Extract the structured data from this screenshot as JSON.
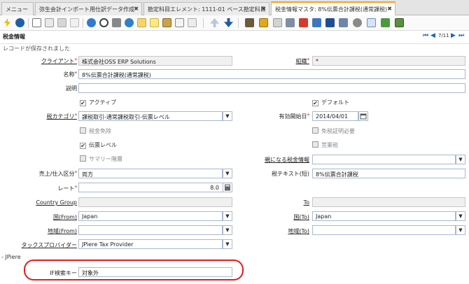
{
  "tabs": [
    {
      "label": "メニュー",
      "close": ""
    },
    {
      "label": "弥生会計インポート用仕訳データ作成",
      "close": "✖"
    },
    {
      "label": "勘定科目エレメント: 1111-01 ベース勘定科目",
      "close": "✖"
    },
    {
      "label": "税金情報マスタ: 8%伝票合計課税(通常課税)",
      "close": "✖"
    }
  ],
  "window_title": "税金情報",
  "nav": {
    "count": "7/11"
  },
  "status_message": "レコードが保存されました",
  "fields": {
    "client": {
      "label": "クライアント",
      "value": "株式会社OSS ERP Solutions"
    },
    "org": {
      "label": "組織",
      "value": "*"
    },
    "name": {
      "label": "名称",
      "value": "8%伝票合計課税(通常課税)"
    },
    "description": {
      "label": "説明",
      "value": ""
    },
    "active": {
      "label": "アクティブ",
      "checked": true
    },
    "default": {
      "label": "デフォルト",
      "checked": true
    },
    "tax_category": {
      "label": "税カテゴリ",
      "value": "課税取引-通常課税取引-伝票レベル"
    },
    "valid_from": {
      "label": "有効開始日",
      "value": "2014/04/01"
    },
    "tax_exempt": {
      "label": "税金免除",
      "checked": false
    },
    "cert_required": {
      "label": "免税証明必要",
      "checked": false
    },
    "doc_level": {
      "label": "伝票レベル",
      "checked": true
    },
    "business_tax": {
      "label": "営業税",
      "checked": false
    },
    "summary_level": {
      "label": "サマリー階層",
      "checked": false
    },
    "parent_tax": {
      "label": "親になる税金情報",
      "value": ""
    },
    "sopo_type": {
      "label": "売上/仕入区分",
      "value": "両方"
    },
    "tax_indicator": {
      "label": "税テキスト(短)",
      "value": "8%伝票合計課税"
    },
    "rate": {
      "label": "レート",
      "value": "8.0"
    },
    "country_group": {
      "label": "Country Group",
      "value": ""
    },
    "to_group": {
      "label": "To",
      "value": ""
    },
    "country_from": {
      "label": "国(From)",
      "value": "Japan"
    },
    "country_to": {
      "label": "国(To)",
      "value": "Japan"
    },
    "region_from": {
      "label": "地域(From)",
      "value": ""
    },
    "region_to": {
      "label": "地域(To)",
      "value": ""
    },
    "tax_provider": {
      "label": "タックスプロバイダー",
      "value": "JPiere Tax Provider"
    }
  },
  "section": {
    "label": "- JPiere"
  },
  "if_search_key": {
    "label": "IF検索キー",
    "value": "対象外"
  },
  "icons": {
    "dropdown": "▼",
    "calendar": "calendar-icon",
    "calculator": "calculator-icon",
    "check": "✔"
  },
  "colors": {
    "highlight": "#e31e1e",
    "active_tab": "#f7a21b"
  }
}
